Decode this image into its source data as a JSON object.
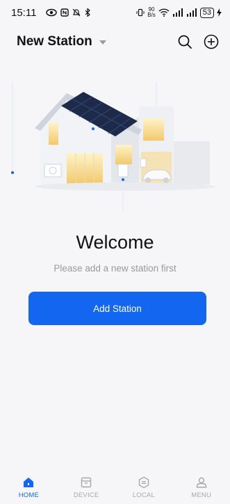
{
  "status_bar": {
    "time": "15:11",
    "net_speed_value": "90",
    "net_speed_unit": "B/s",
    "battery": "53"
  },
  "header": {
    "title": "New Station"
  },
  "main": {
    "welcome": "Welcome",
    "subtitle": "Please add a new station first",
    "add_button_label": "Add Station"
  },
  "bottom_nav": {
    "items": [
      {
        "label": "HOME",
        "icon": "home-icon",
        "active": true
      },
      {
        "label": "DEVICE",
        "icon": "device-icon",
        "active": false
      },
      {
        "label": "LOCAL",
        "icon": "local-icon",
        "active": false
      },
      {
        "label": "MENU",
        "icon": "menu-user-icon",
        "active": false
      }
    ]
  },
  "colors": {
    "accent": "#1366f0",
    "inactive": "#a8a8a8",
    "background": "#f6f6f8"
  }
}
